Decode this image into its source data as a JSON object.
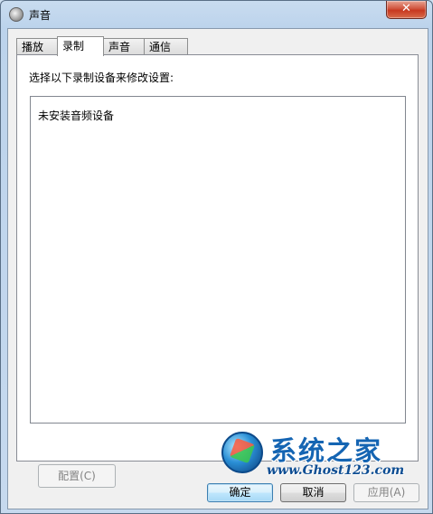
{
  "window": {
    "title": "声音",
    "close_label": "✕"
  },
  "tabs": [
    {
      "label": "播放",
      "active": false
    },
    {
      "label": "录制",
      "active": true
    },
    {
      "label": "声音",
      "active": false
    },
    {
      "label": "通信",
      "active": false
    }
  ],
  "panel": {
    "instruction": "选择以下录制设备来修改设置:",
    "empty_message": "未安装音频设备",
    "configure_label": "配置(C)"
  },
  "buttons": {
    "ok": "确定",
    "cancel": "取消",
    "apply": "应用(A)"
  },
  "watermark": {
    "title": "系统之家",
    "url": "www.Ghost123.com"
  },
  "icons": {
    "title_icon": "speaker-icon",
    "close_icon": "close-icon"
  }
}
